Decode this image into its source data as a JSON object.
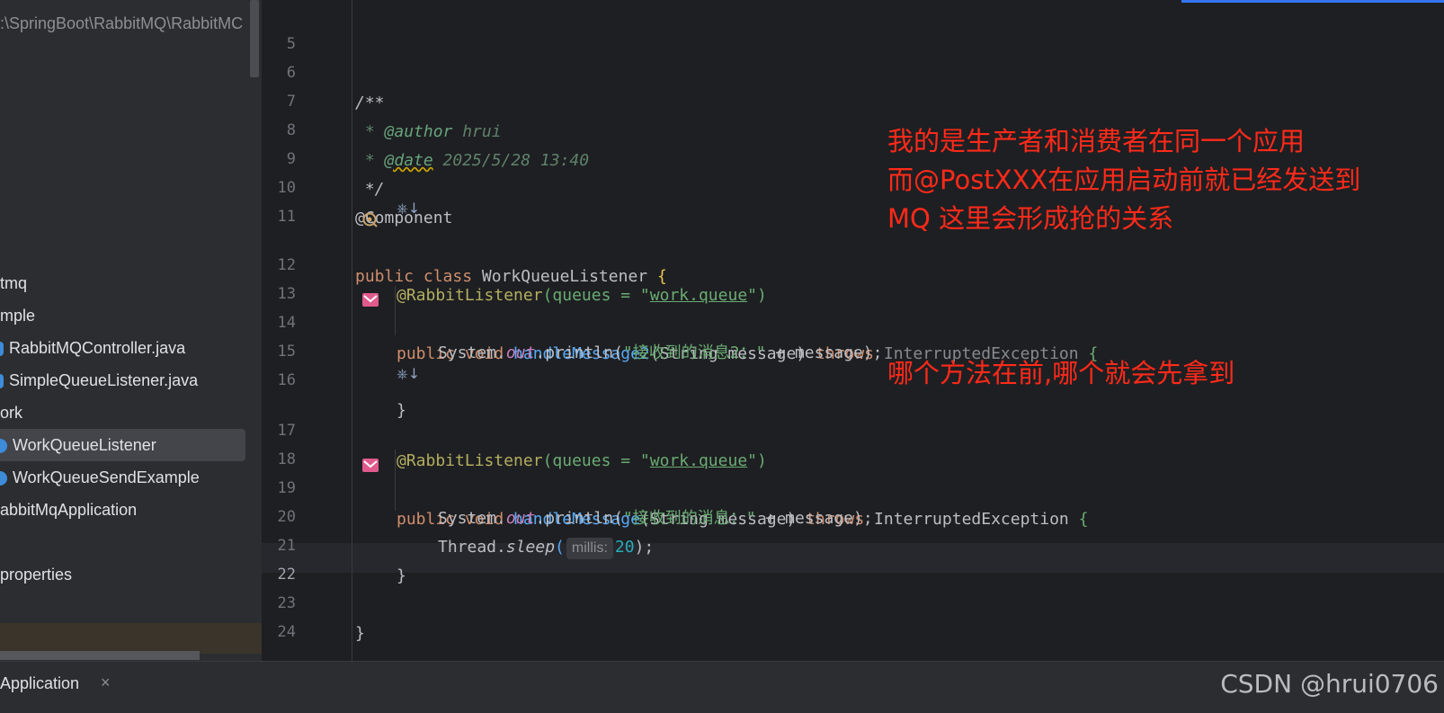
{
  "sidebar": {
    "path": ":\\SpringBoot\\RabbitMQ\\RabbitMC",
    "items": [
      {
        "label": "tmq",
        "icon": "folder-icon"
      },
      {
        "label": "mple",
        "icon": "package-icon"
      },
      {
        "label": "RabbitMQController.java",
        "icon": "java-file-icon"
      },
      {
        "label": "SimpleQueueListener.java",
        "icon": "java-file-icon"
      },
      {
        "label": "ork",
        "icon": "package-icon"
      },
      {
        "label": "WorkQueueListener",
        "icon": "class-icon",
        "selected": true
      },
      {
        "label": "WorkQueueSendExample",
        "icon": "class-icon"
      },
      {
        "label": "abbitMqApplication",
        "icon": "class-icon"
      },
      {
        "label": "",
        "icon": ""
      },
      {
        "label": "properties",
        "icon": "properties-icon"
      }
    ]
  },
  "editor": {
    "line_numbers": [
      "5",
      "6",
      "7",
      "8",
      "9",
      "10",
      "11",
      "12",
      "13",
      "14",
      "15",
      "16",
      "17",
      "18",
      "19",
      "20",
      "21",
      "22",
      "23",
      "24"
    ],
    "current_line": "22",
    "code": {
      "l6": "/**",
      "l7_star": " * ",
      "l7_tag": "@author",
      "l7_val": " hrui",
      "l8_star": " * ",
      "l8_tag": "@date",
      "l8_val": " 2025/5/28 13:40",
      "l9": " */",
      "l10": "@Component",
      "l11_kw": "public class ",
      "l11_name": "WorkQueueListener ",
      "l11_brace": "{",
      "l12_ann": "@RabbitListener",
      "l12_args_open": "(queues = \"",
      "l12_queue": "work.queue",
      "l12_args_close": "\")",
      "l13_kw": "public void ",
      "l13_fn": "handleMessage2",
      "l13_params": "(String message) ",
      "l13_throws": "throws ",
      "l13_ex": "InterruptedException ",
      "l13_brace": "{",
      "l14_a": "System.",
      "l14_out": "out",
      "l14_b": ".println(",
      "l14_str": "\"接收到的消息2：\"",
      "l14_c": " + message);",
      "l16": "}",
      "l17_ann": "@RabbitListener",
      "l17_args_open": "(queues = \"",
      "l17_queue": "work.queue",
      "l17_args_close": "\")",
      "l18_kw": "public void ",
      "l18_fn": "handleMessage",
      "l18_params": "(String message) ",
      "l18_throws": "throws ",
      "l18_ex": "InterruptedException ",
      "l18_brace": "{",
      "l19_a": "System.",
      "l19_out": "out",
      "l19_b": ".println(",
      "l19_str": "\"接收到的消息：\"",
      "l19_c": " + message);",
      "l20_a": "Thread.",
      "l20_sleep": "sleep",
      "l20_paren": "(",
      "l20_hint": "millis:",
      "l20_num": "20",
      "l20_end": ");",
      "l21": "}",
      "l23": "}"
    },
    "inlay_icons": "⎈↓"
  },
  "annotations": {
    "note1_line1": "我的是生产者和消费者在同一个应用",
    "note1_line2": "而@PostXXX在应用启动前就已经发送到",
    "note1_line3": "MQ  这里会形成抢的关系",
    "note2": "哪个方法在前,哪个就会先拿到"
  },
  "bottom": {
    "tab_label": "Application",
    "close_glyph": "×",
    "watermark": "CSDN @hrui0706"
  },
  "colors": {
    "background": "#1e1f22",
    "sidebar": "#2b2d30",
    "annotation": "#ff2a1a",
    "keyword": "#cf8e6d",
    "annotation_code": "#b3ae60",
    "string": "#6aab73",
    "function": "#56a8f5"
  }
}
